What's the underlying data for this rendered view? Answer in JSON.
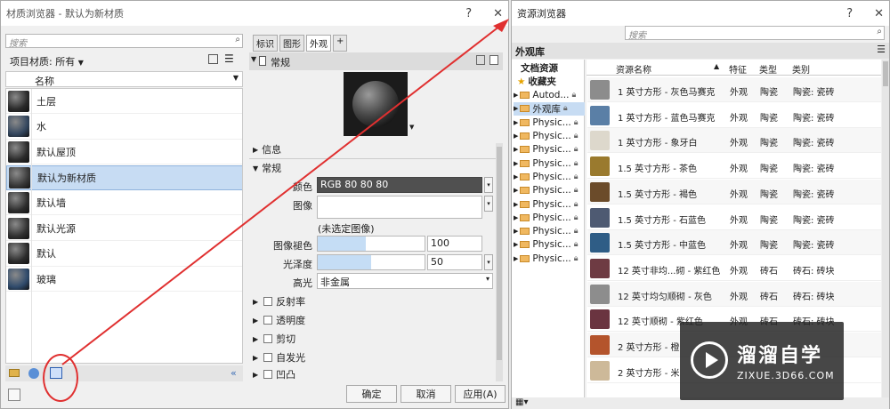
{
  "left_dialog": {
    "title": "材质浏览器 - 默认为新材质",
    "help": "?",
    "close": "✕",
    "search_placeholder": "搜索",
    "project_materials_label": "项目材质: 所有",
    "list_header": "名称",
    "materials": [
      {
        "name": "土层",
        "color": "#2a2a2a",
        "selected": false
      },
      {
        "name": "水",
        "color": "#33465e",
        "selected": false
      },
      {
        "name": "默认屋顶",
        "color": "#2b2b2b",
        "selected": false
      },
      {
        "name": "默认为新材质",
        "color": "#383838",
        "selected": true
      },
      {
        "name": "默认墙",
        "color": "#2d2d2d",
        "selected": false
      },
      {
        "name": "默认光源",
        "color": "#303030",
        "selected": false
      },
      {
        "name": "默认",
        "color": "#2c2c2c",
        "selected": false
      },
      {
        "name": "玻璃",
        "color": "#2f4a6b",
        "selected": false
      }
    ],
    "tabs": [
      "标识",
      "图形",
      "外观",
      "+"
    ],
    "active_tab": "外观",
    "asset_name": "常规",
    "sections": {
      "info": "信息",
      "general": "常规",
      "reflectivity": "反射率",
      "transparency": "透明度",
      "cutout": "剪切",
      "self_illum": "自发光",
      "bump": "凹凸"
    },
    "props": {
      "color_label": "颜色",
      "color_value": "RGB 80 80 80",
      "image_label": "图像",
      "no_image": "(未选定图像)",
      "fade_label": "图像褪色",
      "fade_value": "100",
      "fade_fraction": 0.45,
      "gloss_label": "光泽度",
      "gloss_value": "50",
      "gloss_fraction": 0.5,
      "highlight_label": "高光",
      "highlight_value": "非金属"
    },
    "ok": "确定",
    "cancel": "取消",
    "apply": "应用(A)"
  },
  "right_dialog": {
    "title": "资源浏览器",
    "help": "?",
    "close": "✕",
    "search_placeholder": "搜索",
    "library_title": "外观库",
    "tree": [
      {
        "label": "文档资源",
        "kind": "root"
      },
      {
        "label": "收藏夹",
        "kind": "star"
      },
      {
        "label": "Autod...",
        "kind": "folder"
      },
      {
        "label": "外观库",
        "kind": "folder",
        "selected": true
      },
      {
        "label": "Physic...",
        "kind": "folder"
      },
      {
        "label": "Physic...",
        "kind": "folder"
      },
      {
        "label": "Physic...",
        "kind": "folder"
      },
      {
        "label": "Physic...",
        "kind": "folder"
      },
      {
        "label": "Physic...",
        "kind": "folder"
      },
      {
        "label": "Physic...",
        "kind": "folder"
      },
      {
        "label": "Physic...",
        "kind": "folder"
      },
      {
        "label": "Physic...",
        "kind": "folder"
      },
      {
        "label": "Physic...",
        "kind": "folder"
      },
      {
        "label": "Physic...",
        "kind": "folder"
      },
      {
        "label": "Physic...",
        "kind": "folder"
      }
    ],
    "columns": [
      "资源名称",
      "特征",
      "类型",
      "类别"
    ],
    "rows": [
      {
        "name": "1 英寸方形 - 灰色马赛克",
        "feature": "外观",
        "type": "陶瓷",
        "category": "陶瓷: 瓷砖",
        "color": "#8c8c8c"
      },
      {
        "name": "1 英寸方形 - 蓝色马赛克",
        "feature": "外观",
        "type": "陶瓷",
        "category": "陶瓷: 瓷砖",
        "color": "#5a7fa6"
      },
      {
        "name": "1 英寸方形 - 象牙白",
        "feature": "外观",
        "type": "陶瓷",
        "category": "陶瓷: 瓷砖",
        "color": "#ddd8cc"
      },
      {
        "name": "1.5 英寸方形 - 茶色",
        "feature": "外观",
        "type": "陶瓷",
        "category": "陶瓷: 瓷砖",
        "color": "#9a7a2e"
      },
      {
        "name": "1.5 英寸方形 - 褐色",
        "feature": "外观",
        "type": "陶瓷",
        "category": "陶瓷: 瓷砖",
        "color": "#6b4b2a"
      },
      {
        "name": "1.5 英寸方形 - 石蓝色",
        "feature": "外观",
        "type": "陶瓷",
        "category": "陶瓷: 瓷砖",
        "color": "#4e5a72"
      },
      {
        "name": "1.5 英寸方形 - 中蓝色",
        "feature": "外观",
        "type": "陶瓷",
        "category": "陶瓷: 瓷砖",
        "color": "#2f5d86"
      },
      {
        "name": "12 英寸非均...砌 - 紫红色",
        "feature": "外观",
        "type": "砖石",
        "category": "砖石: 砖块",
        "color": "#6e3b43"
      },
      {
        "name": "12 英寸均匀顺砌 - 灰色",
        "feature": "外观",
        "type": "砖石",
        "category": "砖石: 砖块",
        "color": "#8d8d8d"
      },
      {
        "name": "12 英寸顺砌 - 紫红色",
        "feature": "外观",
        "type": "砖石",
        "category": "砖石: 砖块",
        "color": "#6a3440"
      },
      {
        "name": "2 英寸方形 - 橙",
        "feature": "",
        "type": "",
        "category": "",
        "color": "#b4542c"
      },
      {
        "name": "2 英寸方形 - 米",
        "feature": "",
        "type": "",
        "category": "",
        "color": "#cdb999"
      }
    ],
    "watermark_name": "溜溜自学",
    "watermark_url": "ZIXUE.3D66.COM"
  }
}
